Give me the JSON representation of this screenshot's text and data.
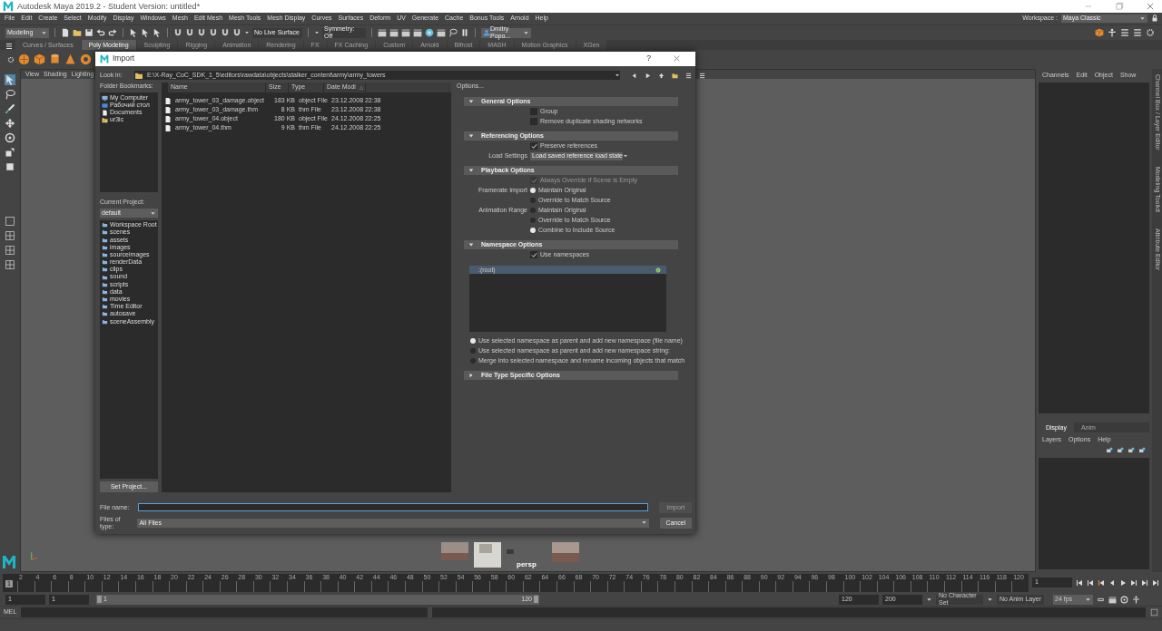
{
  "window": {
    "title": "Autodesk Maya 2019.2 - Student Version: untitled*"
  },
  "menus": [
    "File",
    "Edit",
    "Create",
    "Select",
    "Modify",
    "Display",
    "Windows",
    "Mesh",
    "Edit Mesh",
    "Mesh Tools",
    "Mesh Display",
    "Curves",
    "Surfaces",
    "Deform",
    "UV",
    "Generate",
    "Cache",
    "Bonus Tools",
    "Arnold",
    "Help"
  ],
  "workspace": {
    "label": "Workspace :",
    "value": "Maya Classic"
  },
  "status_line": {
    "mode": "Modeling",
    "live_surface": "No Live Surface",
    "symmetry": "Symmetry: Off",
    "user": "Dmitry Popo..."
  },
  "shelf_tabs": [
    {
      "label": "Curves / Surfaces",
      "selected": false
    },
    {
      "label": "Poly Modeling",
      "selected": true
    },
    {
      "label": "Sculpting",
      "selected": false
    },
    {
      "label": "Rigging",
      "selected": false
    },
    {
      "label": "Animation",
      "selected": false
    },
    {
      "label": "Rendering",
      "selected": false
    },
    {
      "label": "FX",
      "selected": false
    },
    {
      "label": "FX Caching",
      "selected": false
    },
    {
      "label": "Custom",
      "selected": false
    },
    {
      "label": "Arnold",
      "selected": false
    },
    {
      "label": "Bifrost",
      "selected": false
    },
    {
      "label": "MASH",
      "selected": false
    },
    {
      "label": "Motion Graphics",
      "selected": false
    },
    {
      "label": "XGen",
      "selected": false
    }
  ],
  "viewport": {
    "menus": [
      "View",
      "Shading",
      "Lighting"
    ],
    "camera": "persp"
  },
  "channel_box": {
    "menus": [
      "Channels",
      "Edit",
      "Object",
      "Show"
    ]
  },
  "side_tabs": [
    "Channel Box / Layer Editor",
    "Modeling Toolkit",
    "Attribute Editor"
  ],
  "layer_editor": {
    "tabs": [
      {
        "label": "Display",
        "selected": true
      },
      {
        "label": "Anim",
        "selected": false
      }
    ],
    "menus": [
      "Layers",
      "Options",
      "Help"
    ]
  },
  "time_slider": {
    "current_frame": "1",
    "frame_field": "1",
    "ticks": [
      "2",
      "4",
      "6",
      "8",
      "10",
      "12",
      "14",
      "16",
      "18",
      "20",
      "22",
      "24",
      "26",
      "28",
      "30",
      "32",
      "34",
      "36",
      "38",
      "40",
      "42",
      "44",
      "46",
      "48",
      "50",
      "52",
      "54",
      "56",
      "58",
      "60",
      "62",
      "64",
      "66",
      "68",
      "70",
      "72",
      "74",
      "76",
      "78",
      "80",
      "82",
      "84",
      "86",
      "88",
      "90",
      "92",
      "94",
      "96",
      "98",
      "100",
      "102",
      "104",
      "106",
      "108",
      "110",
      "112",
      "114",
      "116",
      "118",
      "120"
    ]
  },
  "range_slider": {
    "start": "1",
    "playback_start": "1",
    "range_start": "1",
    "range_end": "120",
    "playback_end": "120",
    "end": "200",
    "character_set": "No Character Set",
    "anim_layer": "No Anim Layer",
    "fps": "24 fps"
  },
  "command_line": {
    "language": "MEL"
  },
  "import_dialog": {
    "title": "Import",
    "help": "?",
    "look_in_label": "Look in:",
    "path": "E:\\X-Ray_CoC_SDK_1_5\\editors\\rawdata\\objects\\stalker_content\\army\\army_towers",
    "bookmarks_label": "Folder Bookmarks:",
    "bookmarks": [
      {
        "label": "My Computer",
        "kind": "computer"
      },
      {
        "label": "Рабочий стол",
        "kind": "desktop"
      },
      {
        "label": "Documents",
        "kind": "document"
      },
      {
        "label": "ur3ic",
        "kind": "user"
      }
    ],
    "project_label": "Current Project:",
    "project": "default",
    "project_folders": [
      "Workspace Root",
      "scenes",
      "assets",
      "images",
      "sourceimages",
      "renderData",
      "clips",
      "sound",
      "scripts",
      "data",
      "movies",
      "Time Editor",
      "autosave",
      "sceneAssembly"
    ],
    "set_project": "Set Project...",
    "columns": [
      "Name",
      "Size",
      "Type",
      "Date Modi"
    ],
    "files": [
      {
        "name": "army_tower_03_damage.object",
        "size": "183 KB",
        "type": "object File",
        "date": "23.12.2008 22:38"
      },
      {
        "name": "army_tower_03_damage.thm",
        "size": "8 KB",
        "type": "thm File",
        "date": "23.12.2008 22:38"
      },
      {
        "name": "army_tower_04.object",
        "size": "180 KB",
        "type": "object File",
        "date": "24.12.2008 22:25"
      },
      {
        "name": "army_tower_04.thm",
        "size": "9 KB",
        "type": "thm File",
        "date": "24.12.2008 22:25"
      }
    ],
    "options_label": "Options...",
    "sections": [
      {
        "title": "General Options",
        "expanded": true,
        "items": [
          {
            "kind": "checkbox",
            "label": "Group",
            "checked": false,
            "disabled": false
          },
          {
            "kind": "checkbox",
            "label": "Remove duplicate shading networks",
            "checked": false,
            "disabled": false
          }
        ]
      },
      {
        "title": "Referencing Options",
        "expanded": true,
        "items": [
          {
            "kind": "checkbox",
            "label": "Preserve references",
            "checked": true,
            "disabled": false
          },
          {
            "kind": "dropdown",
            "label": "Load Settings",
            "value": "Load saved reference load state"
          }
        ]
      },
      {
        "title": "Playback Options",
        "expanded": true,
        "items": [
          {
            "kind": "checkbox",
            "label": "Always Override if Scene is Empty",
            "checked": true,
            "disabled": true
          },
          {
            "kind": "radio_group",
            "label": "Framerate Import",
            "options": [
              {
                "label": "Maintain Original",
                "selected": true
              },
              {
                "label": "Override to Match Source",
                "selected": false
              }
            ]
          },
          {
            "kind": "radio_group",
            "label": "Animation Range",
            "options": [
              {
                "label": "Maintain Original",
                "selected": false
              },
              {
                "label": "Override to Match Source",
                "selected": false
              },
              {
                "label": "Combine to Include Source",
                "selected": true
              }
            ]
          }
        ]
      },
      {
        "title": "Namespace Options",
        "expanded": true,
        "items": [
          {
            "kind": "checkbox",
            "label": "Use namespaces",
            "checked": true,
            "disabled": false
          },
          {
            "kind": "namespace_list",
            "rows": [
              {
                "label": ":(root)",
                "selected": true
              }
            ]
          },
          {
            "kind": "radio_list",
            "options": [
              {
                "label": "Use selected namespace as parent and add new namespace (file name)",
                "selected": true
              },
              {
                "label": "Use selected namespace as parent and add new namespace string:",
                "selected": false
              },
              {
                "label": "Merge into selected namespace and rename incoming objects that match",
                "selected": false
              }
            ]
          }
        ]
      },
      {
        "title": "File Type Specific Options",
        "expanded": false
      }
    ],
    "file_name_label": "File name:",
    "import_button": {
      "label": "Import",
      "disabled": true
    },
    "files_of_type_label": "Files of type:",
    "files_of_type": "All Files",
    "cancel": "Cancel"
  }
}
